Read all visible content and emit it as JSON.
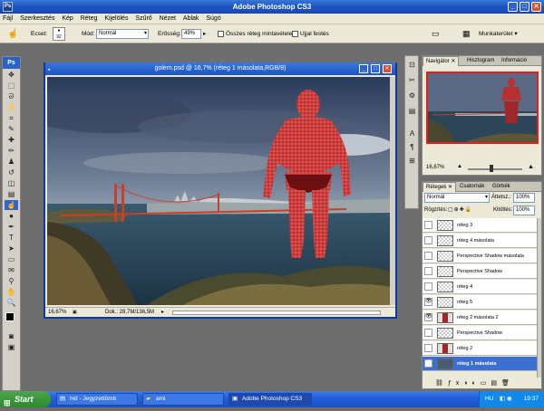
{
  "app": {
    "title": "Adobe Photoshop CS3",
    "logo": "Ps",
    "controls": [
      "_",
      "□",
      "✕"
    ]
  },
  "menu": [
    "Fájl",
    "Szerkesztés",
    "Kép",
    "Réteg",
    "Kijelölés",
    "Szűrő",
    "Nézet",
    "Ablak",
    "Súgó"
  ],
  "options": {
    "brush_label": "Ecset:",
    "brush_size": "92",
    "mode_label": "Mód:",
    "mode_value": "Normál",
    "strength_label": "Erősség:",
    "strength_value": "49%",
    "sample_all_label": "Összes réteg mintavétele",
    "finger_label": "Ujjal festés",
    "workspace_label": "Munkaterület"
  },
  "document": {
    "title": "golem.psd @ 16,7% (réteg 1 másolata,RGB/8)",
    "zoom": "16,67%",
    "doc_info": "Dok.: 28,7M/136,5M"
  },
  "navigator": {
    "tabs": [
      "Navigátor",
      "Hisztogram",
      "Információ"
    ],
    "zoom": "16,67%"
  },
  "layers_panel": {
    "tabs": [
      "Rétegek",
      "Csatornák",
      "Görbék"
    ],
    "blend_mode": "Normál",
    "opacity_label": "Áttetsz.:",
    "opacity_value": "100%",
    "lock_label": "Rögzítés:",
    "fill_label": "Kitöltés:",
    "fill_value": "100%",
    "layers": [
      {
        "name": "réteg 3",
        "visible": false,
        "selected": false
      },
      {
        "name": "réteg 4 másolata",
        "visible": false,
        "selected": false
      },
      {
        "name": "Perspective Shadow másolata",
        "visible": false,
        "selected": false
      },
      {
        "name": "Perspective Shadow",
        "visible": false,
        "selected": false
      },
      {
        "name": "réteg 4",
        "visible": false,
        "selected": false
      },
      {
        "name": "réteg 5",
        "visible": true,
        "selected": false
      },
      {
        "name": "réteg 2 másolata 2",
        "visible": true,
        "selected": false
      },
      {
        "name": "Perspective Shadow",
        "visible": false,
        "selected": false
      },
      {
        "name": "réteg 2",
        "visible": false,
        "selected": false
      },
      {
        "name": "réteg 1 másolata",
        "visible": true,
        "selected": true
      }
    ]
  },
  "taskbar": {
    "start": "Start",
    "tasks": [
      "hid - Jegyzettömb",
      "ami",
      "Adobe Photoshop CS3"
    ],
    "lang": "HU",
    "time": "19:37"
  }
}
